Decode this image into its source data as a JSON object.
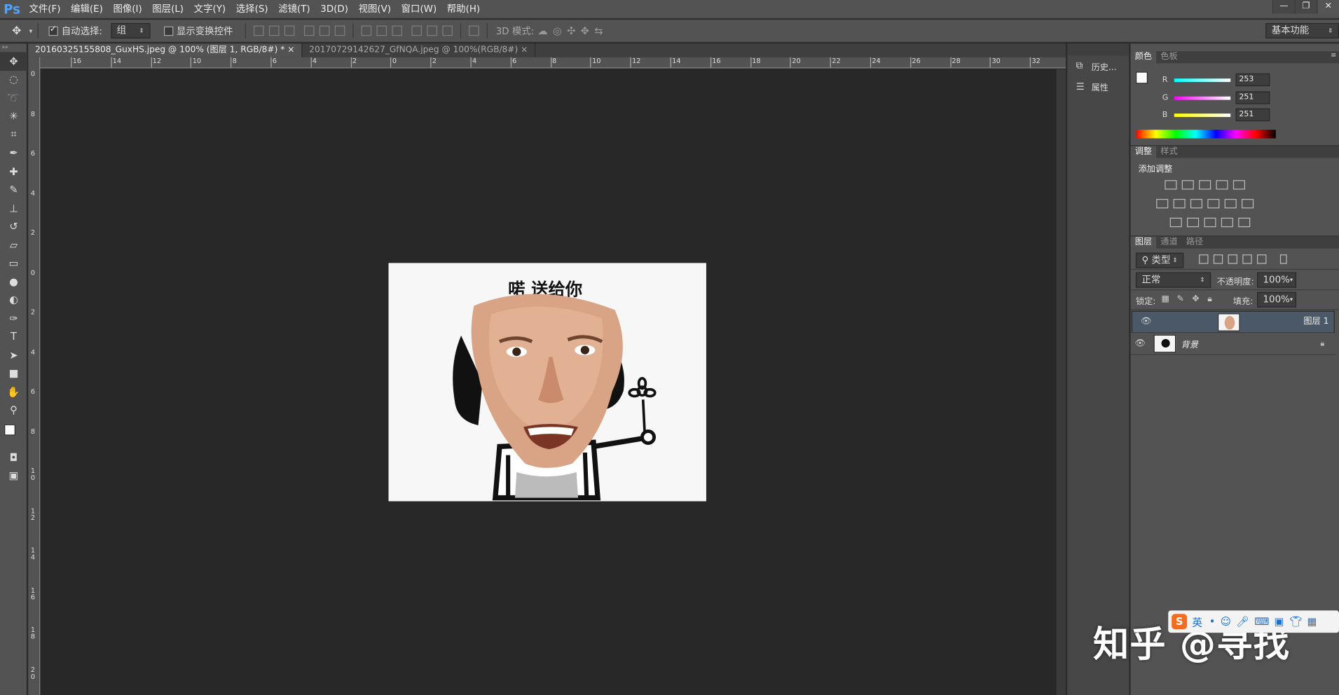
{
  "app": {
    "logo": "Ps"
  },
  "menu": [
    "文件(F)",
    "编辑(E)",
    "图像(I)",
    "图层(L)",
    "文字(Y)",
    "选择(S)",
    "滤镜(T)",
    "3D(D)",
    "视图(V)",
    "窗口(W)",
    "帮助(H)"
  ],
  "window_buttons": [
    "—",
    "❐",
    "✕"
  ],
  "options": {
    "auto_select_label": "自动选择:",
    "auto_select_checked": true,
    "auto_select_value": "组",
    "show_transform_label": "显示变换控件",
    "mode_3d_label": "3D 模式:",
    "workspace": "基本功能"
  },
  "tabs": [
    {
      "label": "20160325155808_GuxHS.jpeg @ 100% (图层 1, RGB/8#) *",
      "active": true
    },
    {
      "label": "20170729142627_GfNQA.jpeg @ 100%(RGB/8#)",
      "active": false
    }
  ],
  "tab_close": "×",
  "ruler": {
    "h_labels": [
      "16",
      "14",
      "12",
      "10",
      "8",
      "6",
      "4",
      "2",
      "0",
      "2",
      "4",
      "6",
      "8",
      "10",
      "12",
      "14",
      "16",
      "18",
      "20",
      "22",
      "24",
      "26",
      "28",
      "30",
      "32"
    ],
    "v_labels": [
      "0",
      "8",
      "6",
      "4",
      "2",
      "0",
      "2",
      "4",
      "6",
      "8",
      "1 0",
      "1 2",
      "1 4",
      "1 6",
      "1 8",
      "2 0"
    ]
  },
  "canvas_image": {
    "caption": "喏 送给你"
  },
  "dock_items": [
    {
      "icon": "history-icon",
      "label": "历史..."
    },
    {
      "icon": "properties-icon",
      "label": "属性"
    }
  ],
  "color_panel": {
    "tabs": [
      "颜色",
      "色板"
    ],
    "channels": [
      {
        "name": "R",
        "value": "253"
      },
      {
        "name": "G",
        "value": "251"
      },
      {
        "name": "B",
        "value": "251"
      }
    ]
  },
  "adjust_panel": {
    "tabs": [
      "调整",
      "样式"
    ],
    "title": "添加调整"
  },
  "layers_panel": {
    "tabs": [
      "图层",
      "通道",
      "路径"
    ],
    "filter_kind": "类型",
    "blend_mode": "正常",
    "opacity_label": "不透明度:",
    "opacity": "100%",
    "lock_label": "锁定:",
    "fill_label": "填充:",
    "fill": "100%",
    "layers": [
      {
        "name": "图层 1",
        "selected": true,
        "locked": false
      },
      {
        "name": "背景",
        "selected": false,
        "locked": true
      }
    ]
  },
  "watermark": "知乎 @寻找",
  "ime": {
    "logo": "S",
    "mode": "英"
  },
  "colors": {
    "accent": "#4fa3ff",
    "ui_dark": "#282828",
    "panel": "#535353"
  }
}
